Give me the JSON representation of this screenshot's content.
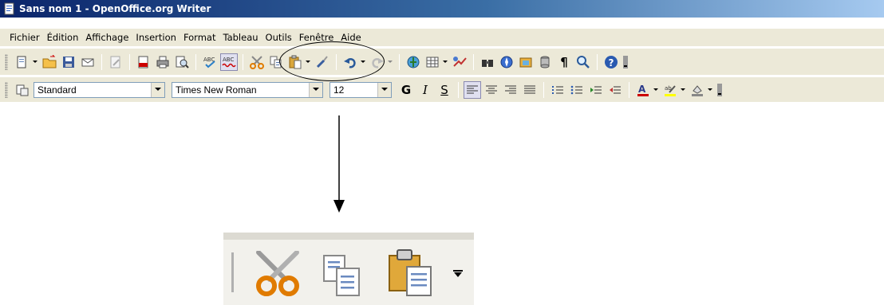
{
  "window": {
    "title": "Sans nom 1 - OpenOffice.org Writer",
    "icon": "writer-doc-icon"
  },
  "menu": {
    "items": [
      "Fichier",
      "Édition",
      "Affichage",
      "Insertion",
      "Format",
      "Tableau",
      "Outils",
      "Fenêtre",
      "Aide"
    ]
  },
  "toolbar_standard": {
    "icons": [
      "new-icon",
      "open-folder-icon",
      "save-icon",
      "email-icon",
      "edit-file-icon",
      "export-pdf-icon",
      "print-icon",
      "print-preview-icon",
      "spellcheck-icon",
      "autospellcheck-icon",
      "cut-icon",
      "copy-icon",
      "paste-icon",
      "clone-format-icon",
      "undo-icon",
      "redo-icon",
      "hyperlink-icon",
      "table-icon",
      "draw-functions-icon",
      "find-replace-icon",
      "navigator-icon",
      "gallery-icon",
      "data-sources-icon",
      "formatting-marks-icon",
      "zoom-icon",
      "help-icon"
    ]
  },
  "toolbar_format": {
    "style_value": "Standard",
    "font_value": "Times New Roman",
    "size_value": "12",
    "bold_glyph": "G",
    "italic_glyph": "I",
    "underline_glyph": "S",
    "accent_color": "#cc0000",
    "highlight_color": "#ffff00"
  },
  "zoom_panel": {
    "icons": [
      "cut-icon",
      "copy-icon",
      "paste-icon"
    ]
  }
}
